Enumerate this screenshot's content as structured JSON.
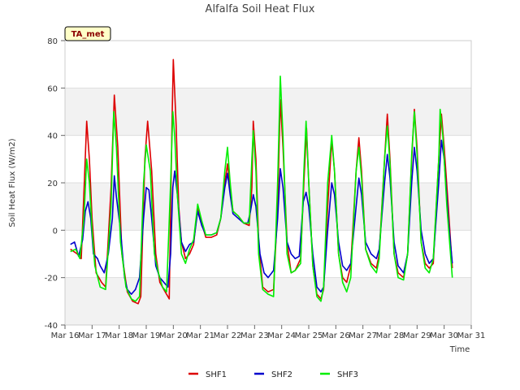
{
  "chart_data": {
    "type": "line",
    "title": "Alfalfa Soil Heat Flux",
    "xlabel": "Time",
    "ylabel": "Soil Heat Flux (W/m2)",
    "badge": "TA_met",
    "xlim": [
      0,
      15
    ],
    "ylim": [
      -40,
      80
    ],
    "x_ticks": [
      {
        "x": 0,
        "label": "Mar 16"
      },
      {
        "x": 1,
        "label": "Mar 17"
      },
      {
        "x": 2,
        "label": "Mar 18"
      },
      {
        "x": 3,
        "label": "Mar 19"
      },
      {
        "x": 4,
        "label": "Mar 20"
      },
      {
        "x": 5,
        "label": "Mar 21"
      },
      {
        "x": 6,
        "label": "Mar 22"
      },
      {
        "x": 7,
        "label": "Mar 23"
      },
      {
        "x": 8,
        "label": "Mar 24"
      },
      {
        "x": 9,
        "label": "Mar 25"
      },
      {
        "x": 10,
        "label": "Mar 26"
      },
      {
        "x": 11,
        "label": "Mar 27"
      },
      {
        "x": 12,
        "label": "Mar 28"
      },
      {
        "x": 13,
        "label": "Mar 29"
      },
      {
        "x": 14,
        "label": "Mar 30"
      },
      {
        "x": 15,
        "label": "Mar 31"
      }
    ],
    "y_ticks": [
      -40,
      -20,
      0,
      20,
      40,
      60,
      80
    ],
    "grid": true,
    "legend_position": "bottom",
    "series": [
      {
        "name": "SHF1",
        "color": "#dd0000",
        "points": [
          [
            0.2,
            -8
          ],
          [
            0.45,
            -10
          ],
          [
            0.6,
            -12
          ],
          [
            0.72,
            22
          ],
          [
            0.8,
            46
          ],
          [
            0.9,
            30
          ],
          [
            1.0,
            5
          ],
          [
            1.15,
            -18
          ],
          [
            1.35,
            -22
          ],
          [
            1.5,
            -24
          ],
          [
            1.7,
            18
          ],
          [
            1.82,
            57
          ],
          [
            1.95,
            35
          ],
          [
            2.1,
            -10
          ],
          [
            2.3,
            -26
          ],
          [
            2.5,
            -30
          ],
          [
            2.7,
            -31
          ],
          [
            2.8,
            -28
          ],
          [
            2.95,
            30
          ],
          [
            3.05,
            46
          ],
          [
            3.2,
            25
          ],
          [
            3.35,
            -10
          ],
          [
            3.5,
            -22
          ],
          [
            3.7,
            -26
          ],
          [
            3.85,
            -29
          ],
          [
            3.95,
            45
          ],
          [
            4.0,
            72
          ],
          [
            4.1,
            45
          ],
          [
            4.2,
            10
          ],
          [
            4.3,
            -5
          ],
          [
            4.45,
            -12
          ],
          [
            4.6,
            -10
          ],
          [
            4.75,
            -6
          ],
          [
            4.9,
            10
          ],
          [
            5.05,
            3
          ],
          [
            5.2,
            -3
          ],
          [
            5.4,
            -3
          ],
          [
            5.6,
            -2
          ],
          [
            5.75,
            5
          ],
          [
            5.9,
            20
          ],
          [
            6.0,
            28
          ],
          [
            6.1,
            18
          ],
          [
            6.2,
            8
          ],
          [
            6.4,
            6
          ],
          [
            6.6,
            3
          ],
          [
            6.8,
            2
          ],
          [
            6.9,
            18
          ],
          [
            6.95,
            46
          ],
          [
            7.05,
            30
          ],
          [
            7.15,
            -5
          ],
          [
            7.3,
            -24
          ],
          [
            7.5,
            -26
          ],
          [
            7.7,
            -25
          ],
          [
            7.85,
            10
          ],
          [
            7.95,
            55
          ],
          [
            8.05,
            35
          ],
          [
            8.2,
            -5
          ],
          [
            8.35,
            -18
          ],
          [
            8.5,
            -17
          ],
          [
            8.7,
            -12
          ],
          [
            8.82,
            20
          ],
          [
            8.92,
            43
          ],
          [
            9.0,
            20
          ],
          [
            9.15,
            -15
          ],
          [
            9.3,
            -27
          ],
          [
            9.45,
            -29
          ],
          [
            9.55,
            -25
          ],
          [
            9.7,
            10
          ],
          [
            9.85,
            38
          ],
          [
            9.95,
            25
          ],
          [
            10.1,
            -10
          ],
          [
            10.25,
            -20
          ],
          [
            10.4,
            -22
          ],
          [
            10.55,
            -15
          ],
          [
            10.75,
            25
          ],
          [
            10.85,
            39
          ],
          [
            10.95,
            25
          ],
          [
            11.1,
            -8
          ],
          [
            11.3,
            -14
          ],
          [
            11.5,
            -16
          ],
          [
            11.6,
            -10
          ],
          [
            11.8,
            30
          ],
          [
            11.9,
            49
          ],
          [
            12.0,
            30
          ],
          [
            12.15,
            -10
          ],
          [
            12.3,
            -18
          ],
          [
            12.5,
            -20
          ],
          [
            12.65,
            -10
          ],
          [
            12.8,
            30
          ],
          [
            12.9,
            51
          ],
          [
            13.0,
            35
          ],
          [
            13.15,
            -5
          ],
          [
            13.3,
            -14
          ],
          [
            13.45,
            -16
          ],
          [
            13.6,
            -14
          ],
          [
            13.8,
            30
          ],
          [
            13.9,
            49
          ],
          [
            14.0,
            35
          ],
          [
            14.15,
            10
          ],
          [
            14.3,
            -16
          ]
        ]
      },
      {
        "name": "SHF2",
        "color": "#0000cc",
        "points": [
          [
            0.2,
            -6
          ],
          [
            0.35,
            -5
          ],
          [
            0.5,
            -11
          ],
          [
            0.65,
            -4
          ],
          [
            0.75,
            8
          ],
          [
            0.85,
            12
          ],
          [
            0.95,
            5
          ],
          [
            1.05,
            -10
          ],
          [
            1.2,
            -12
          ],
          [
            1.3,
            -15
          ],
          [
            1.45,
            -18
          ],
          [
            1.6,
            -10
          ],
          [
            1.75,
            5
          ],
          [
            1.82,
            23
          ],
          [
            1.9,
            14
          ],
          [
            2.05,
            0
          ],
          [
            2.2,
            -20
          ],
          [
            2.3,
            -25
          ],
          [
            2.45,
            -27
          ],
          [
            2.6,
            -25
          ],
          [
            2.75,
            -20
          ],
          [
            2.9,
            5
          ],
          [
            3.0,
            18
          ],
          [
            3.1,
            17
          ],
          [
            3.2,
            5
          ],
          [
            3.35,
            -15
          ],
          [
            3.5,
            -20
          ],
          [
            3.65,
            -22
          ],
          [
            3.8,
            -24
          ],
          [
            3.9,
            -10
          ],
          [
            3.98,
            18
          ],
          [
            4.05,
            25
          ],
          [
            4.15,
            15
          ],
          [
            4.3,
            -5
          ],
          [
            4.45,
            -9
          ],
          [
            4.6,
            -6
          ],
          [
            4.75,
            -5
          ],
          [
            4.9,
            8
          ],
          [
            5.05,
            2
          ],
          [
            5.2,
            -2
          ],
          [
            5.4,
            -2
          ],
          [
            5.6,
            -1
          ],
          [
            5.75,
            5
          ],
          [
            5.9,
            18
          ],
          [
            6.0,
            24
          ],
          [
            6.1,
            15
          ],
          [
            6.2,
            7
          ],
          [
            6.4,
            5
          ],
          [
            6.6,
            3
          ],
          [
            6.75,
            3
          ],
          [
            6.85,
            8
          ],
          [
            6.95,
            15
          ],
          [
            7.05,
            10
          ],
          [
            7.2,
            -10
          ],
          [
            7.35,
            -18
          ],
          [
            7.5,
            -20
          ],
          [
            7.7,
            -17
          ],
          [
            7.85,
            5
          ],
          [
            7.95,
            26
          ],
          [
            8.05,
            18
          ],
          [
            8.2,
            -5
          ],
          [
            8.35,
            -10
          ],
          [
            8.5,
            -12
          ],
          [
            8.65,
            -11
          ],
          [
            8.8,
            12
          ],
          [
            8.9,
            16
          ],
          [
            9.0,
            10
          ],
          [
            9.15,
            -10
          ],
          [
            9.3,
            -24
          ],
          [
            9.45,
            -26
          ],
          [
            9.55,
            -24
          ],
          [
            9.7,
            0
          ],
          [
            9.85,
            20
          ],
          [
            9.95,
            15
          ],
          [
            10.1,
            -5
          ],
          [
            10.25,
            -15
          ],
          [
            10.4,
            -17
          ],
          [
            10.55,
            -14
          ],
          [
            10.75,
            10
          ],
          [
            10.85,
            22
          ],
          [
            10.95,
            15
          ],
          [
            11.1,
            -5
          ],
          [
            11.3,
            -10
          ],
          [
            11.5,
            -12
          ],
          [
            11.6,
            -8
          ],
          [
            11.8,
            20
          ],
          [
            11.9,
            32
          ],
          [
            12.0,
            22
          ],
          [
            12.15,
            -5
          ],
          [
            12.3,
            -15
          ],
          [
            12.5,
            -18
          ],
          [
            12.65,
            -10
          ],
          [
            12.8,
            20
          ],
          [
            12.9,
            35
          ],
          [
            13.0,
            25
          ],
          [
            13.15,
            0
          ],
          [
            13.3,
            -10
          ],
          [
            13.45,
            -14
          ],
          [
            13.6,
            -12
          ],
          [
            13.8,
            20
          ],
          [
            13.9,
            38
          ],
          [
            14.0,
            30
          ],
          [
            14.15,
            5
          ],
          [
            14.3,
            -14
          ]
        ]
      },
      {
        "name": "SHF3",
        "color": "#00ee00",
        "points": [
          [
            0.2,
            -9
          ],
          [
            0.4,
            -8
          ],
          [
            0.55,
            -12
          ],
          [
            0.7,
            5
          ],
          [
            0.8,
            30
          ],
          [
            0.9,
            20
          ],
          [
            1.0,
            0
          ],
          [
            1.1,
            -15
          ],
          [
            1.3,
            -24
          ],
          [
            1.5,
            -25
          ],
          [
            1.7,
            10
          ],
          [
            1.8,
            50
          ],
          [
            1.9,
            35
          ],
          [
            2.05,
            -5
          ],
          [
            2.25,
            -24
          ],
          [
            2.45,
            -29
          ],
          [
            2.6,
            -30
          ],
          [
            2.75,
            -28
          ],
          [
            2.9,
            20
          ],
          [
            3.0,
            36
          ],
          [
            3.15,
            25
          ],
          [
            3.3,
            -10
          ],
          [
            3.45,
            -18
          ],
          [
            3.6,
            -24
          ],
          [
            3.75,
            -26
          ],
          [
            3.9,
            20
          ],
          [
            3.98,
            50
          ],
          [
            4.05,
            40
          ],
          [
            4.15,
            15
          ],
          [
            4.3,
            -10
          ],
          [
            4.45,
            -14
          ],
          [
            4.6,
            -8
          ],
          [
            4.75,
            -4
          ],
          [
            4.9,
            11
          ],
          [
            5.05,
            4
          ],
          [
            5.2,
            -2
          ],
          [
            5.4,
            -2
          ],
          [
            5.6,
            -1
          ],
          [
            5.75,
            5
          ],
          [
            5.9,
            25
          ],
          [
            6.0,
            35
          ],
          [
            6.1,
            20
          ],
          [
            6.2,
            8
          ],
          [
            6.4,
            6
          ],
          [
            6.6,
            3
          ],
          [
            6.8,
            3
          ],
          [
            6.9,
            30
          ],
          [
            6.95,
            42
          ],
          [
            7.05,
            25
          ],
          [
            7.15,
            -10
          ],
          [
            7.3,
            -25
          ],
          [
            7.5,
            -27
          ],
          [
            7.7,
            -28
          ],
          [
            7.85,
            20
          ],
          [
            7.95,
            65
          ],
          [
            8.05,
            40
          ],
          [
            8.2,
            -10
          ],
          [
            8.35,
            -18
          ],
          [
            8.5,
            -17
          ],
          [
            8.7,
            -14
          ],
          [
            8.82,
            25
          ],
          [
            8.9,
            46
          ],
          [
            9.0,
            20
          ],
          [
            9.15,
            -15
          ],
          [
            9.3,
            -28
          ],
          [
            9.45,
            -30
          ],
          [
            9.55,
            -24
          ],
          [
            9.7,
            20
          ],
          [
            9.85,
            40
          ],
          [
            9.95,
            25
          ],
          [
            10.1,
            -10
          ],
          [
            10.25,
            -22
          ],
          [
            10.4,
            -26
          ],
          [
            10.55,
            -20
          ],
          [
            10.75,
            25
          ],
          [
            10.85,
            35
          ],
          [
            10.95,
            22
          ],
          [
            11.1,
            -8
          ],
          [
            11.3,
            -15
          ],
          [
            11.5,
            -18
          ],
          [
            11.6,
            -12
          ],
          [
            11.8,
            30
          ],
          [
            11.9,
            44
          ],
          [
            12.0,
            28
          ],
          [
            12.15,
            -10
          ],
          [
            12.3,
            -20
          ],
          [
            12.5,
            -21
          ],
          [
            12.65,
            -10
          ],
          [
            12.8,
            32
          ],
          [
            12.9,
            50
          ],
          [
            13.0,
            32
          ],
          [
            13.15,
            -5
          ],
          [
            13.3,
            -16
          ],
          [
            13.45,
            -18
          ],
          [
            13.6,
            -12
          ],
          [
            13.8,
            30
          ],
          [
            13.85,
            51
          ],
          [
            13.95,
            40
          ],
          [
            14.1,
            10
          ],
          [
            14.3,
            -20
          ]
        ]
      }
    ]
  }
}
